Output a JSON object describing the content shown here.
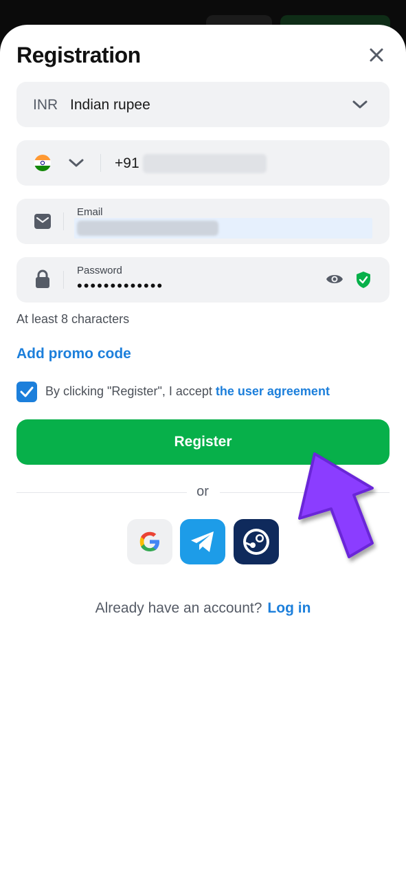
{
  "modal": {
    "title": "Registration",
    "close_icon": "close-icon"
  },
  "currency": {
    "code": "INR",
    "name": "Indian rupee"
  },
  "phone": {
    "prefix": "+91",
    "country_flag": "india-flag-icon"
  },
  "email": {
    "label": "Email"
  },
  "password": {
    "label": "Password",
    "masked_value": "•••••••••••••"
  },
  "hint": "At least 8 characters",
  "promo": "Add promo code",
  "agreement": {
    "text": "By clicking \"Register\", I accept ",
    "link": "the user agreement",
    "checked": true
  },
  "register_label": "Register",
  "or_label": "or",
  "social": [
    "google-icon",
    "telegram-icon",
    "steam-icon"
  ],
  "login": {
    "prompt": "Already have an account?",
    "link": "Log in"
  },
  "colors": {
    "accent_green": "#07b04a",
    "link_blue": "#1c7fdb",
    "arrow_purple": "#8b3dff"
  }
}
